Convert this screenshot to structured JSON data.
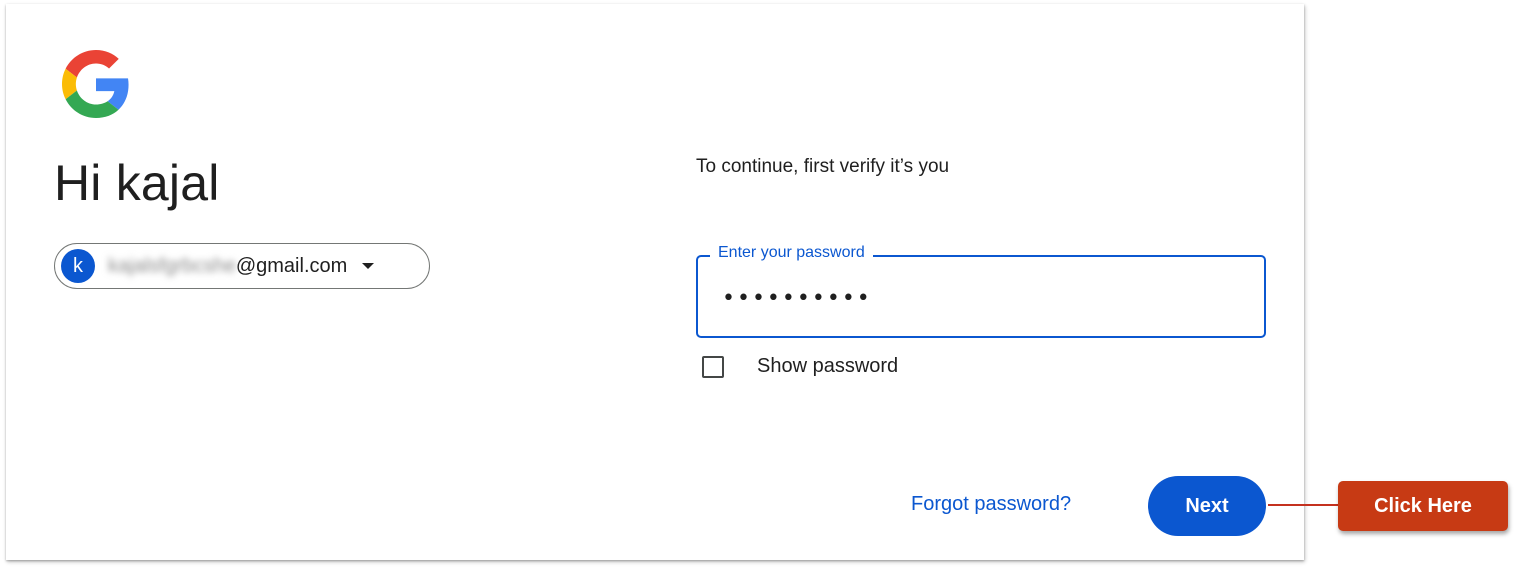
{
  "greeting": "Hi kajal",
  "account": {
    "avatar_letter": "k",
    "email_masked": "kajalsfgrbcshe",
    "email_domain": "@gmail.com"
  },
  "subtitle": "To continue, first verify it’s you",
  "password": {
    "label": "Enter your password",
    "value": "••••••••••"
  },
  "show_password": {
    "label": "Show password",
    "checked": false
  },
  "forgot_password": "Forgot password?",
  "next_button": "Next",
  "callout": "Click Here",
  "colors": {
    "primary": "#0b57d0",
    "callout": "#c73a14",
    "text": "#1f1f1f"
  },
  "icons": [
    "google-logo-icon",
    "chevron-down-icon"
  ]
}
